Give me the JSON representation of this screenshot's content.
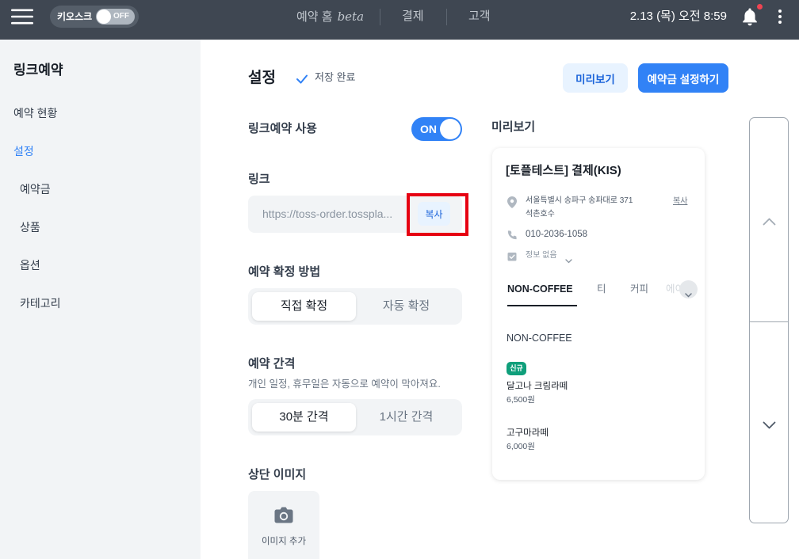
{
  "topbar": {
    "kiosk": {
      "label": "키오스크",
      "state": "OFF"
    },
    "nav": [
      {
        "label": "예약 홈",
        "badge": "beta"
      },
      {
        "label": "결제"
      },
      {
        "label": "고객"
      }
    ],
    "datetime": "2.13 (목) 오전 8:59",
    "has_unread_notification": true
  },
  "sidebar": {
    "title": "링크예약",
    "items": [
      {
        "label": "예약 현황",
        "active": false,
        "is_subitem": false
      },
      {
        "label": "설정",
        "active": true,
        "is_subitem": false
      },
      {
        "label": "예약금",
        "active": false,
        "is_subitem": true
      },
      {
        "label": "상품",
        "active": false,
        "is_subitem": true
      },
      {
        "label": "옵션",
        "active": false,
        "is_subitem": true
      },
      {
        "label": "카테고리",
        "active": false,
        "is_subitem": true
      }
    ]
  },
  "header": {
    "title": "설정",
    "save_status": "저장 완료",
    "preview_button": "미리보기",
    "deposit_button": "예약금 설정하기"
  },
  "settings": {
    "link_booking": {
      "label": "링크예약 사용",
      "toggle_state": "ON"
    },
    "link": {
      "label": "링크",
      "url": "https://toss-order.tosspla...",
      "copy_button": "복사"
    },
    "confirm_method": {
      "label": "예약 확정 방법",
      "options": [
        "직접 확정",
        "자동 확정"
      ],
      "selected_index": 0
    },
    "interval": {
      "label": "예약 간격",
      "description": "개인 일정, 휴무일은 자동으로 예약이 막아져요.",
      "options": [
        "30분 간격",
        "1시간 간격"
      ],
      "selected_index": 0
    },
    "top_image": {
      "label": "상단 이미지",
      "add_label": "이미지 추가"
    }
  },
  "preview": {
    "label": "미리보기",
    "store_name": "[토플테스트] 결제(KIS)",
    "address_line1": "서울특별시 송파구 송파대로 371",
    "address_line2": "석촌호수",
    "address_copy": "복사",
    "phone": "010-2036-1058",
    "info": "정보 없음",
    "tabs": [
      "NON-COFFEE",
      "티",
      "커피",
      "에이"
    ],
    "active_tab_index": 0,
    "section_title": "NON-COFFEE",
    "products": [
      {
        "badge": "신규",
        "name": "달고나 크림라떼",
        "price": "6,500원"
      },
      {
        "name": "고구마라떼",
        "price": "6,000원"
      }
    ]
  },
  "icons": {
    "menu": "menu-icon",
    "notification": "bell-icon",
    "more": "kebab-menu-icon",
    "saved": "check-icon",
    "camera": "camera-icon",
    "location": "location-pin-icon",
    "phone": "phone-icon",
    "info": "calendar-check-icon",
    "tab_more": "chevron-down-icon",
    "scroll_up": "chevron-up-icon",
    "scroll_down": "chevron-down-icon"
  },
  "colors": {
    "accent": "#3182f6",
    "accent_light": "#e8f3ff",
    "topbar": "#3f4752",
    "sidebar_bg": "#f2f4f6",
    "badge_new": "#0f9f7b",
    "notification_dot": "#f04452",
    "highlight": "#e60012"
  }
}
